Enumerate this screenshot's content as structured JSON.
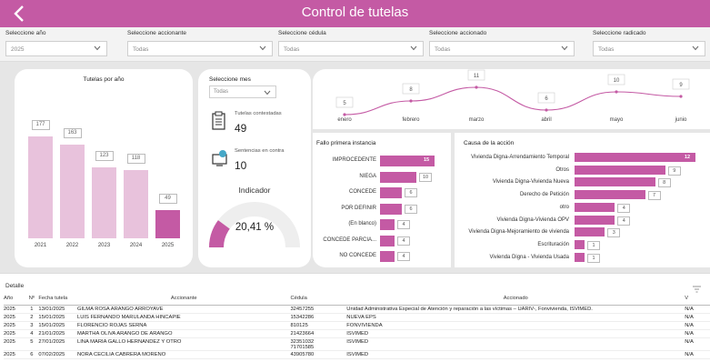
{
  "header": {
    "title": "Control de tutelas"
  },
  "filters": [
    {
      "label": "Seleccione año",
      "value": "2025"
    },
    {
      "label": "Seleccione accionante",
      "value": "Todas"
    },
    {
      "label": "Seleccione cédula",
      "value": "Todas"
    },
    {
      "label": "Seleccione accionado",
      "value": "Todas"
    },
    {
      "label": "Seleccione radicado",
      "value": "Todas"
    }
  ],
  "year_chart": {
    "title": "Tutelas por año",
    "chart_data": {
      "type": "bar",
      "categories": [
        "2021",
        "2022",
        "2023",
        "2024",
        "2025"
      ],
      "values": [
        177,
        163,
        123,
        118,
        49
      ],
      "highlight": "2025",
      "colors": {
        "normal": "#e8c2dc",
        "highlight": "#c45aa4"
      }
    }
  },
  "kpis": {
    "month_label": "Seleccione mes",
    "month_value": "Todas",
    "contestadas_label": "Tutelas contestadas",
    "contestadas_value": "49",
    "sentencias_label": "Sentencias en contra",
    "sentencias_value": "10",
    "indicador_label": "Indicador",
    "indicador_value": "20,41 %",
    "indicador_fraction": 0.2041
  },
  "monthly_chart": {
    "chart_data": {
      "type": "line",
      "categories": [
        "enero",
        "febrero",
        "marzo",
        "abril",
        "mayo",
        "junio"
      ],
      "values": [
        5,
        8,
        11,
        6,
        10,
        9
      ],
      "color": "#c45aa4"
    }
  },
  "fallo_chart": {
    "title": "Fallo primera instancia",
    "chart_data": {
      "type": "bar",
      "orientation": "horizontal",
      "categories": [
        "IMPROCEDENTE",
        "NIEGA",
        "CONCEDE",
        "POR DEFINIR",
        "(En blanco)",
        "CONCEDE PARCIA...",
        "NO CONCEDE"
      ],
      "values": [
        15,
        10,
        6,
        6,
        4,
        4,
        4
      ],
      "color": "#c45aa4"
    }
  },
  "causa_chart": {
    "title": "Causa de la acción",
    "chart_data": {
      "type": "bar",
      "orientation": "horizontal",
      "categories": [
        "Vivienda Digna-Arrendamiento Temporal",
        "Otros",
        "Vivienda Digna-Vivienda Nueva",
        "Derecho de Petición",
        "otro",
        "Vivienda Digna-Vivienda OPV",
        "Vivienda Digna-Mejoramiento de vivienda",
        "Escrituración",
        "Vivienda Digna - Vivienda Usada"
      ],
      "values": [
        12,
        9,
        8,
        7,
        4,
        4,
        3,
        1,
        1
      ],
      "color": "#c45aa4"
    }
  },
  "detail": {
    "title": "Detalle",
    "columns": [
      "Año",
      "Nº",
      "Fecha tutela",
      "Accionante",
      "Cédula",
      "Accionado",
      "V"
    ],
    "rows": [
      [
        "2025",
        "1",
        "13/01/2025",
        "GILMA ROSA ARANGO ARROYAVE",
        "32457255",
        "Unidad Administrativa Especial de Atención y reparación a las víctimas – UARIV-, Fonvivienda, ISVIMED.",
        "N/A"
      ],
      [
        "2025",
        "2",
        "15/01/2025",
        "LUIS FERNANDO MARULANDA HINCAPIE",
        "15342286",
        "NUEVA EPS",
        "N/A"
      ],
      [
        "2025",
        "3",
        "15/01/2025",
        "FLORENCIO ROJAS SERNA",
        "810125",
        "FONVIVIENDA",
        "N/A"
      ],
      [
        "2025",
        "4",
        "21/01/2025",
        "MARTHA OLIVA ARANGO DE ARANGO",
        "21423664",
        "ISVIMED",
        "N/A"
      ],
      [
        "2025",
        "5",
        "27/01/2025",
        "LINA MARIA GALLO HERNANDEZ Y OTRO",
        "32351032\n71701585",
        "ISVIMED",
        "N/A"
      ],
      [
        "2025",
        "6",
        "07/02/2025",
        "NORA CECILIA CABRERA MORENO",
        "43905780",
        "ISVIMED",
        "N/A"
      ]
    ]
  }
}
